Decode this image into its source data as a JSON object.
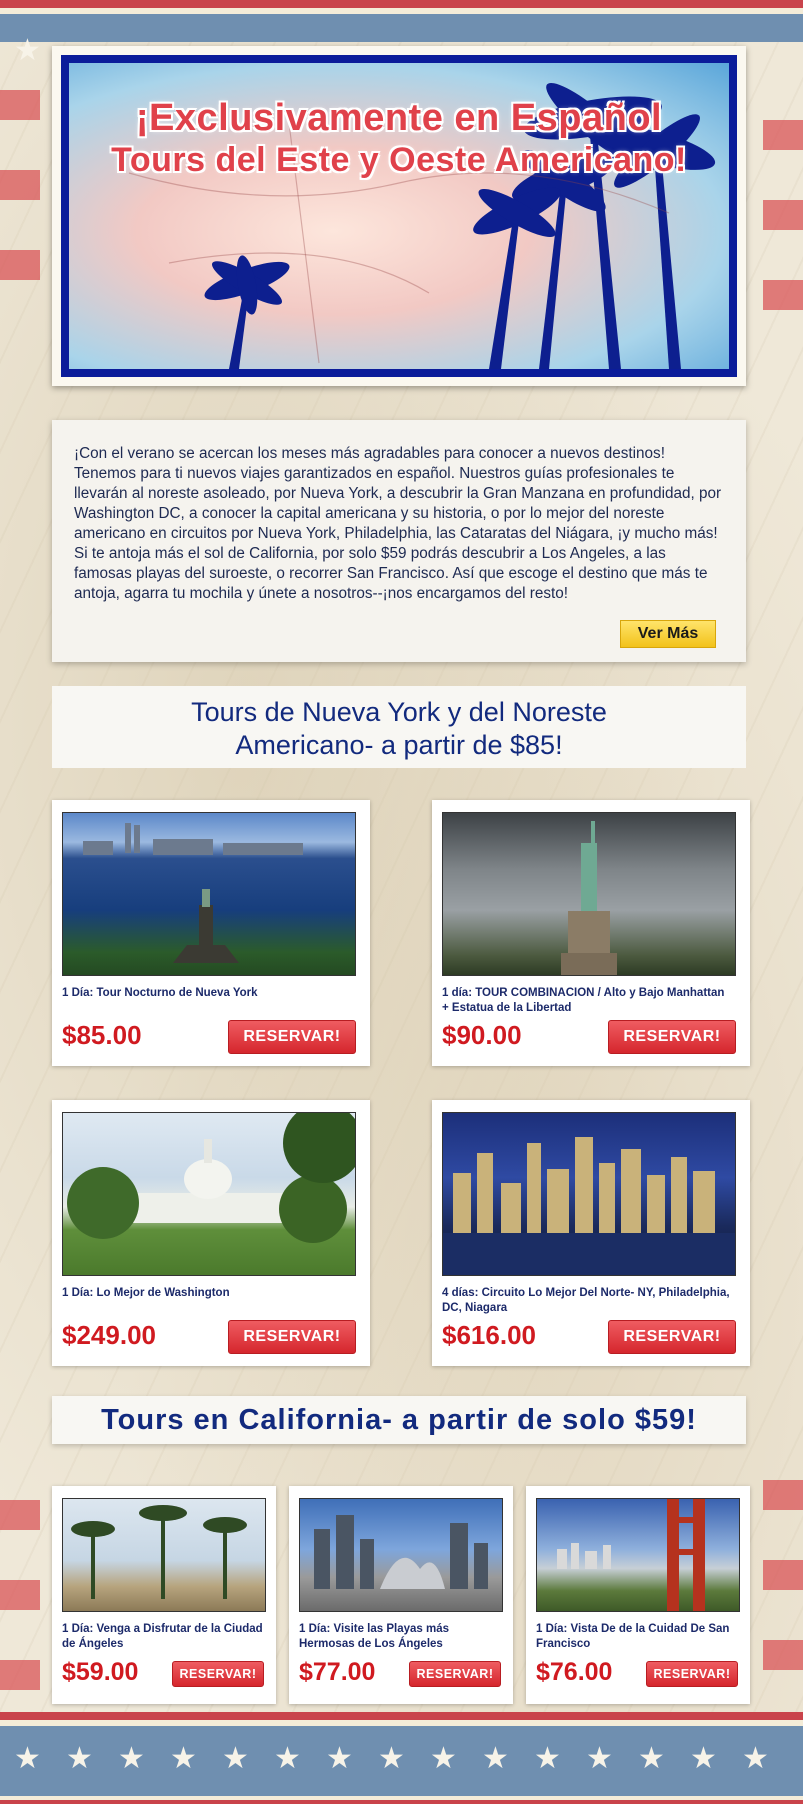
{
  "hero": {
    "title_line1": "¡Exclusivamente en Español",
    "title_line2": "Tours del Este y Oeste Americano!"
  },
  "intro": {
    "text": "¡Con el verano se acercan los meses más agradables para conocer a nuevos destinos! Tenemos para ti nuevos viajes garantizados en español. Nuestros guías profesionales te llevarán al noreste asoleado, por Nueva York, a descubrir la Gran Manzana en profundidad, por Washington DC, a conocer la capital americana y su historia, o por lo mejor del noreste americano en circuitos por Nueva York, Philadelphia, las Cataratas del Niágara, ¡y mucho más! Si te antoja más el sol de California, por solo $59 podrás descubrir a Los Angeles, a las famosas playas del suroeste, o recorrer San Francisco. Así que escoge el destino que más te antoja, agarra tu mochila y únete a nosotros--¡nos encargamos del resto!",
    "button": "Ver Más"
  },
  "sections": {
    "northeast_title": "Tours de Nueva York y del Noreste Americano- a partir de $85!",
    "california_title": "Tours en California- a partir de solo $59!"
  },
  "northeast_tours": [
    {
      "desc": "1 Día: Tour Nocturno de Nueva York",
      "price": "$85.00",
      "button": "RESERVAR!"
    },
    {
      "desc": "1 día: TOUR COMBINACION / Alto y Bajo Manhattan + Estatua de la Libertad",
      "price": "$90.00",
      "button": "RESERVAR!"
    },
    {
      "desc": "1 Día: Lo Mejor de Washington",
      "price": "$249.00",
      "button": "RESERVAR!"
    },
    {
      "desc": "4 días: Circuito Lo Mejor Del Norte- NY, Philadelphia, DC, Niagara",
      "price": "$616.00",
      "button": "RESERVAR!"
    }
  ],
  "california_tours": [
    {
      "desc": "1 Día: Venga a Disfrutar de la Ciudad de Ángeles",
      "price": "$59.00",
      "button": "RESERVAR!"
    },
    {
      "desc": "1 Día: Visite las Playas más Hermosas de Los Ángeles",
      "price": "$77.00",
      "button": "RESERVAR!"
    },
    {
      "desc": "1 Día: Vista De de la Cuidad De San Francisco",
      "price": "$76.00",
      "button": "RESERVAR!"
    }
  ],
  "colors": {
    "price_red": "#d01a20",
    "heading_blue": "#122a7e",
    "hero_frame_blue": "#0b1c9a",
    "button_yellow": "#f2c21a",
    "reserve_red": "#d5262d"
  },
  "icons": {
    "star": "star-icon"
  }
}
